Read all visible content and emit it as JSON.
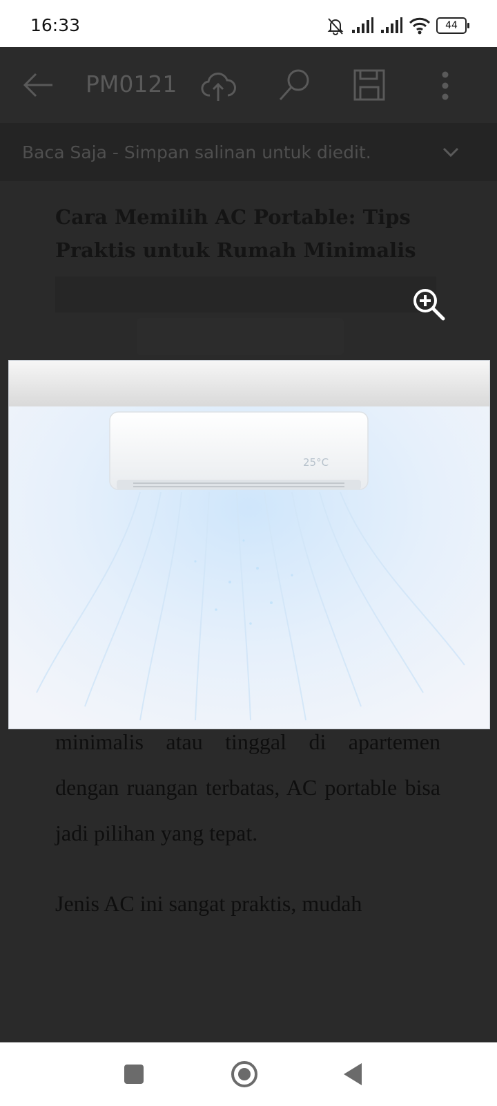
{
  "status_bar": {
    "time": "16:33",
    "battery_level": "44",
    "icons": [
      "bell-off-icon",
      "signal-icon",
      "signal-icon",
      "wifi-icon",
      "battery-icon"
    ]
  },
  "toolbar": {
    "title": "PM0121",
    "icons": [
      "back-arrow-icon",
      "cloud-upload-icon",
      "search-icon",
      "save-icon",
      "more-vert-icon"
    ]
  },
  "banner": {
    "text": "Baca Saja - Simpan salinan untuk diedit.",
    "icon": "chevron-down-icon"
  },
  "article": {
    "title": "Cara Memilih AC Portable: Tips Praktis untuk Rumah Minimalis",
    "paragraph_1": "minimalis atau tinggal di apartemen dengan ruangan terbatas, AC portable bisa jadi pilihan yang tepat.",
    "paragraph_2": "Jenis AC ini sangat praktis, mudah"
  },
  "image": {
    "ac_display": "25°C",
    "zoom_icon": "zoom-in-icon"
  },
  "nav_bar": {
    "icons": [
      "recents-square-icon",
      "home-circle-icon",
      "back-triangle-icon"
    ]
  }
}
